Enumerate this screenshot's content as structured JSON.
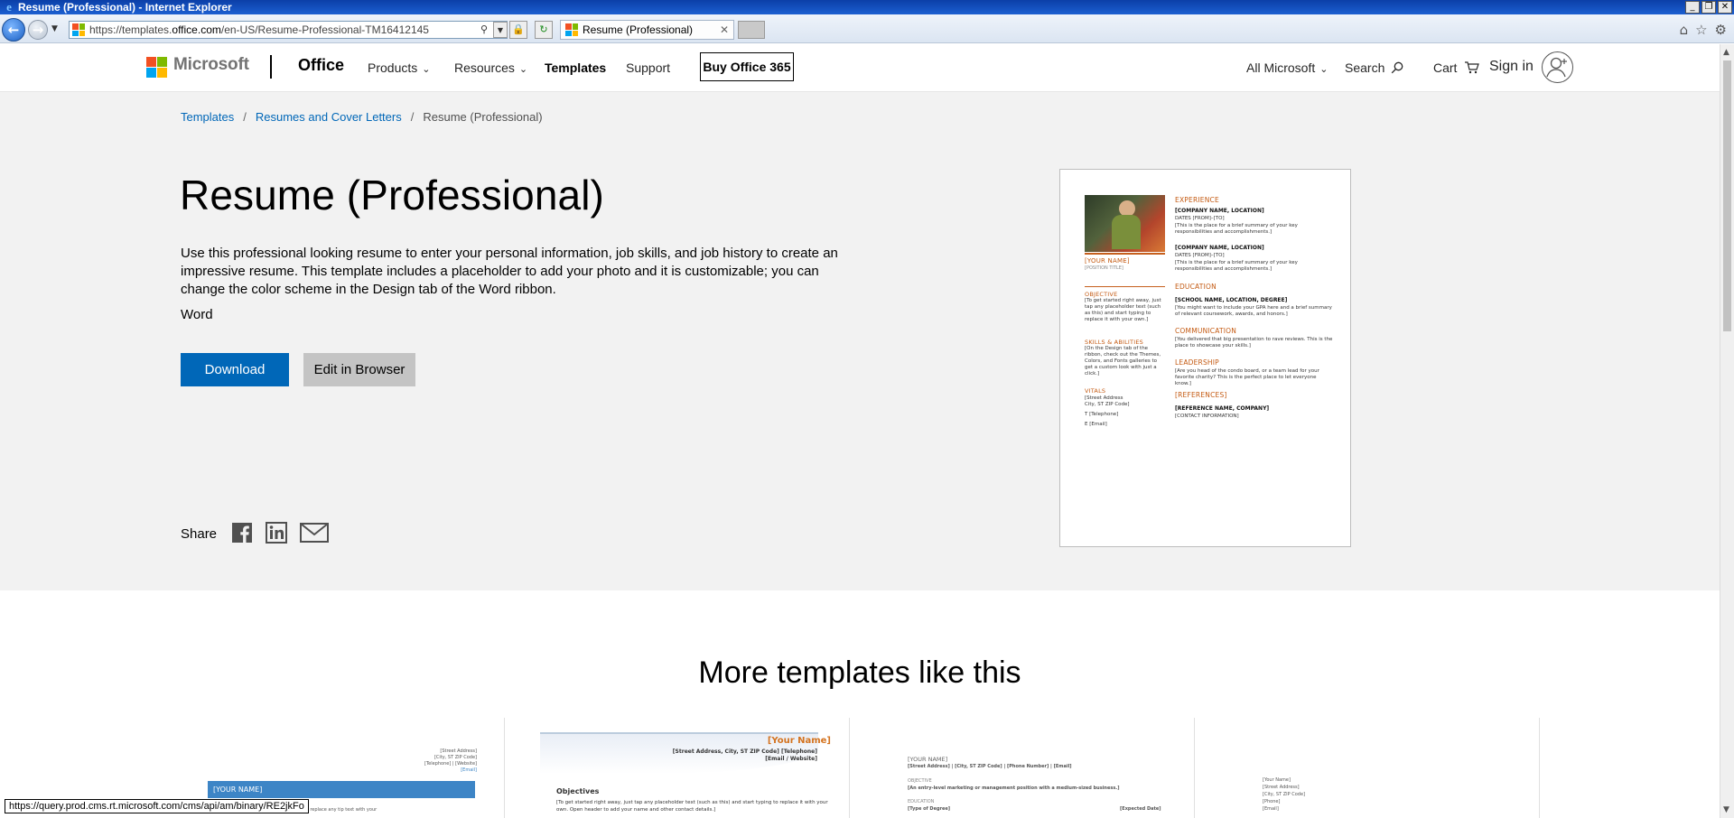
{
  "window": {
    "title": "Resume (Professional) - Internet Explorer",
    "minimize": "_",
    "restore": "❐",
    "close": "✕"
  },
  "browser": {
    "address_prefix": "https://templates.",
    "address_host": "office.com",
    "address_suffix": "/en-US/Resume-Professional-TM16412145",
    "tab_title": "Resume (Professional)",
    "tab_close": "✕",
    "status_url": "https://query.prod.cms.rt.microsoft.com/cms/api/am/binary/RE2jkFo",
    "icons": [
      "back-arrow-icon",
      "forward-arrow-icon",
      "search-icon",
      "lock-icon",
      "refresh-icon",
      "home-icon",
      "favorites-star-icon",
      "tools-gear-icon"
    ]
  },
  "header": {
    "brand": "Microsoft",
    "product": "Office",
    "nav": [
      "Products",
      "Resources",
      "Templates",
      "Support"
    ],
    "buy_button": "Buy Office 365",
    "all_microsoft": "All Microsoft",
    "search": "Search",
    "cart": "Cart",
    "signin": "Sign in"
  },
  "breadcrumb": {
    "items": [
      "Templates",
      "Resumes and Cover Letters",
      "Resume (Professional)"
    ]
  },
  "template": {
    "title": "Resume (Professional)",
    "description": "Use this professional looking resume to enter your personal information, job skills, and job history to create an impressive resume. This template includes a placeholder to add your photo and it is customizable; you can change the color scheme in the Design tab of the Word ribbon.",
    "app": "Word",
    "download": "Download",
    "edit_in_browser": "Edit in Browser",
    "share_label": "Share"
  },
  "preview": {
    "your_name": "[YOUR NAME]",
    "position_title": "[POSITION TITLE]",
    "objective_h": "OBJECTIVE",
    "objective_t": "[To get started right away, just tap any placeholder text (such as this) and start typing to replace it with your own.]",
    "skills_h": "SKILLS & ABILITIES",
    "skills_t": "[On the Design tab of the ribbon, check out the Themes, Colors, and Fonts galleries to get a custom look with just a click.]",
    "vitals_h": "VITALS",
    "vitals_addr": "[Street Address",
    "vitals_city": "City, ST ZIP Code]",
    "vitals_tel": "T [Telephone]",
    "vitals_email": "E [Email]",
    "experience_h": "EXPERIENCE",
    "company1": "[COMPANY NAME, LOCATION]",
    "dates1": "DATES [FROM]–[TO]",
    "summary1": "[This is the place for a brief summary of your key responsibilities and accomplishments.]",
    "company2": "[COMPANY NAME, LOCATION]",
    "dates2": "DATES [FROM]–[TO]",
    "summary2": "[This is the place for a brief summary of your key responsibilities and accomplishments.]",
    "education_h": "EDUCATION",
    "school": "[SCHOOL NAME, LOCATION, DEGREE]",
    "school_t": "[You might want to include your GPA here and a brief summary of relevant coursework, awards, and honors.]",
    "communication_h": "COMMUNICATION",
    "communication_t": "[You delivered that big presentation to rave reviews. This is the place to showcase your skills.]",
    "leadership_h": "LEADERSHIP",
    "leadership_t": "[Are you head of the condo board, or a team lead for your favorite charity? This is the perfect place to let everyone know.]",
    "references_h": "[REFERENCES]",
    "reference_name": "[REFERENCE NAME, COMPANY]",
    "reference_contact": "[CONTACT INFORMATION]"
  },
  "more": {
    "heading": "More templates like this",
    "card1": {
      "addr1": "[Street Address]",
      "addr2": "[City, ST ZIP Code]",
      "addr3": "[Telephone] | [Website]",
      "addr4": "[Email]",
      "name": "[YOUR NAME]",
      "body": "Use this template to help you get started. To replace any tip text with your"
    },
    "card2": {
      "name": "[Your Name]",
      "contact1": "[Street Address, City, ST ZIP Code] [Telephone]",
      "contact2": "[Email / Website]",
      "objectives": "Objectives",
      "body1": "[To get started right away, just tap any placeholder text (such as this) and start typing to replace it with your",
      "body2": "own. Open header to add your name and other contact details.]"
    },
    "card3": {
      "name": "[YOUR NAME]",
      "contact": "[Street Address] | [City, ST ZIP Code] | [Phone Number] | [Email]",
      "objective_h": "OBJECTIVE",
      "objective_t": "[An entry-level marketing or management position with a medium-sized business.]",
      "education_h": "EDUCATION",
      "degree": "[Type of Degree]",
      "grad": "[Expected Date]"
    },
    "card4": {
      "name": "[Your Name]",
      "address": "[Street Address]",
      "city": "[City, ST ZIP Code]",
      "phone": "[Phone]",
      "email": "[Email]"
    }
  }
}
